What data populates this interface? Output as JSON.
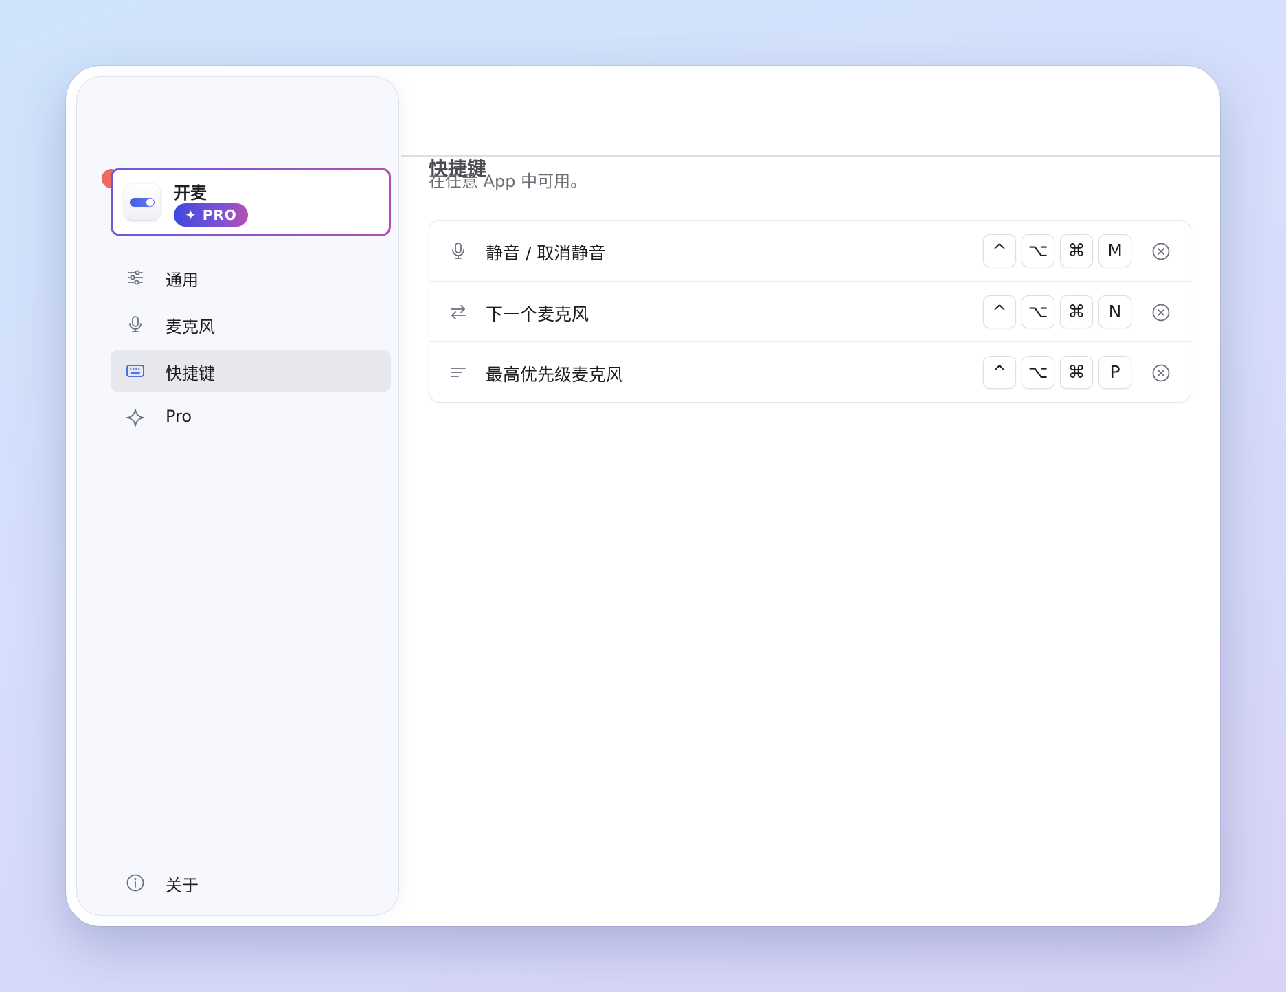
{
  "window": {
    "traffic_lights": {
      "close": "#ec6a5f",
      "minimize": "#f4c64f",
      "zoom": "#d4d5da"
    }
  },
  "sidebar": {
    "app": {
      "name": "开麦",
      "badge": "✦ PRO",
      "icon": "toggle-switch-icon"
    },
    "items": [
      {
        "label": "通用",
        "icon": "sliders-icon",
        "selected": false
      },
      {
        "label": "麦克风",
        "icon": "microphone-icon",
        "selected": false
      },
      {
        "label": "快捷键",
        "icon": "keyboard-icon",
        "selected": true
      },
      {
        "label": "Pro",
        "icon": "sparkle-icon",
        "selected": false
      }
    ],
    "footer": {
      "label": "关于",
      "icon": "info-icon"
    }
  },
  "main": {
    "title": "快捷键",
    "subtitle": "在任意 App 中可用。",
    "shortcuts": [
      {
        "label": "静音 / 取消静音",
        "icon": "microphone-icon",
        "keys": [
          "^",
          "⌥",
          "⌘",
          "M"
        ]
      },
      {
        "label": "下一个麦克风",
        "icon": "swap-arrows-icon",
        "keys": [
          "^",
          "⌥",
          "⌘",
          "N"
        ]
      },
      {
        "label": "最高优先级麦克风",
        "icon": "priority-lines-icon",
        "keys": [
          "^",
          "⌥",
          "⌘",
          "P"
        ]
      }
    ]
  },
  "colors": {
    "accent": "#3f5fe0",
    "badge_gradient_start": "#3e49e0",
    "badge_gradient_end": "#b54fb1",
    "selected_bg": "#e6e8ee",
    "sidebar_bg": "#f6f8fd"
  }
}
